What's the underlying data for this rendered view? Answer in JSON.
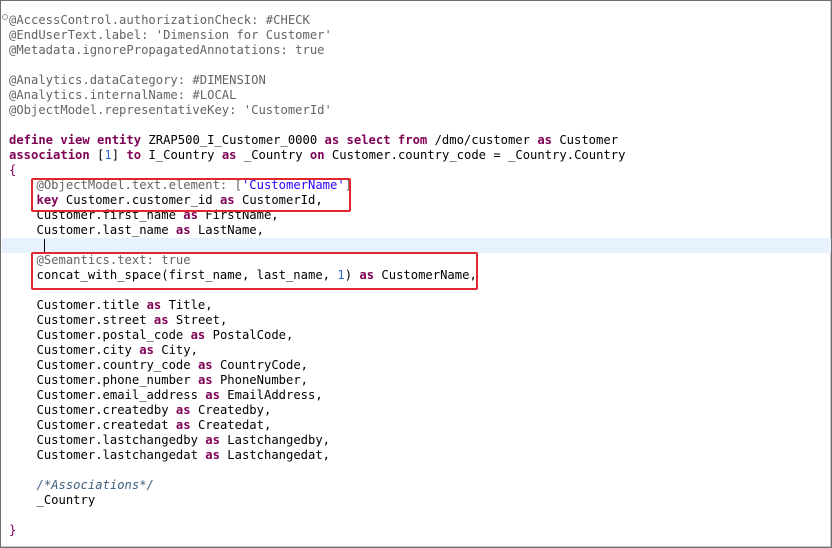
{
  "editor": {
    "lines": [
      {
        "text": "@AccessControl.authorizationCheck: #CHECK"
      },
      {
        "text": "@EndUserText.label: 'Dimension for Customer'"
      },
      {
        "text": "@Metadata.ignorePropagatedAnnotations: true"
      },
      {
        "text": ""
      },
      {
        "text": "@Analytics.dataCategory: #DIMENSION"
      },
      {
        "text": "@Analytics.internalName: #LOCAL"
      },
      {
        "text": "@ObjectModel.representativeKey: 'CustomerId'"
      },
      {
        "text": ""
      },
      {
        "text": "define view entity ZRAP500_I_Customer_0000 as select from /dmo/customer as Customer"
      },
      {
        "text": "association [1] to I_Country as _Country on Customer.country_code = _Country.Country"
      },
      {
        "text": "{"
      },
      {
        "text": "    @ObjectModel.text.element: ['CustomerName']"
      },
      {
        "text": "    key Customer.customer_id as CustomerId,"
      },
      {
        "text": "    Customer.first_name as FirstName,"
      },
      {
        "text": "    Customer.last_name as LastName,"
      },
      {
        "text": "    "
      },
      {
        "text": "    @Semantics.text: true"
      },
      {
        "text": "    concat_with_space(first_name, last_name, 1) as CustomerName,"
      },
      {
        "text": ""
      },
      {
        "text": "    Customer.title as Title,"
      },
      {
        "text": "    Customer.street as Street,"
      },
      {
        "text": "    Customer.postal_code as PostalCode,"
      },
      {
        "text": "    Customer.city as City,"
      },
      {
        "text": "    Customer.country_code as CountryCode,"
      },
      {
        "text": "    Customer.phone_number as PhoneNumber,"
      },
      {
        "text": "    Customer.email_address as EmailAddress,"
      },
      {
        "text": "    Customer.createdby as Createdby,"
      },
      {
        "text": "    Customer.createdat as Createdat,"
      },
      {
        "text": "    Customer.lastchangedby as Lastchangedby,"
      },
      {
        "text": "    Customer.lastchangedat as Lastchangedat,"
      },
      {
        "text": ""
      },
      {
        "text": "    /*Associations*/"
      },
      {
        "text": "    _Country"
      },
      {
        "text": ""
      },
      {
        "text": "}"
      }
    ],
    "tokens": {
      "l0": "@AccessControl.authorizationCheck: #CHECK",
      "l1": "@EndUserText.label: 'Dimension for Customer'",
      "l2": "@Metadata.ignorePropagatedAnnotations: true",
      "l4": "@Analytics.dataCategory: #DIMENSION",
      "l5": "@Analytics.internalName: #LOCAL",
      "l6": "@ObjectModel.representativeKey: 'CustomerId'",
      "l8_kw1": "define view entity",
      "l8_a": " ZRAP500_I_Customer_0000 ",
      "l8_kw2": "as select from",
      "l8_b": " /dmo/customer ",
      "l8_kw3": "as",
      "l8_c": " Customer",
      "l9_kw1": "association",
      "l9_a": " [",
      "l9_num": "1",
      "l9_b": "] ",
      "l9_kw2": "to",
      "l9_c": " I_Country ",
      "l9_kw3": "as",
      "l9_d": " _Country ",
      "l9_kw4": "on",
      "l9_e": " Customer.country_code = _Country.Country",
      "l10": "{",
      "l11_anno": "@ObjectModel.text.element: [",
      "l11_str": "'CustomerName'",
      "l11_end": "]",
      "l12_kw": "key",
      "l12_a": " Customer.customer_id ",
      "l12_kw2": "as",
      "l12_b": " CustomerId,",
      "l13_a": "Customer.first_name ",
      "l13_kw": "as",
      "l13_b": " FirstName,",
      "l14_a": "Customer.last_name ",
      "l14_kw": "as",
      "l14_b": " LastName,",
      "l16": "@Semantics.text: true",
      "l17_a": "concat_with_space(first_name, last_name, ",
      "l17_num": "1",
      "l17_b": ") ",
      "l17_kw": "as",
      "l17_c": " CustomerName,",
      "l19_a": "Customer.title ",
      "l19_kw": "as",
      "l19_b": " Title,",
      "l20_a": "Customer.street ",
      "l20_kw": "as",
      "l20_b": " Street,",
      "l21_a": "Customer.postal_code ",
      "l21_kw": "as",
      "l21_b": " PostalCode,",
      "l22_a": "Customer.city ",
      "l22_kw": "as",
      "l22_b": " City,",
      "l23_a": "Customer.country_code ",
      "l23_kw": "as",
      "l23_b": " CountryCode,",
      "l24_a": "Customer.phone_number ",
      "l24_kw": "as",
      "l24_b": " PhoneNumber,",
      "l25_a": "Customer.email_address ",
      "l25_kw": "as",
      "l25_b": " EmailAddress,",
      "l26_a": "Customer.createdby ",
      "l26_kw": "as",
      "l26_b": " Createdby,",
      "l27_a": "Customer.createdat ",
      "l27_kw": "as",
      "l27_b": " Createdat,",
      "l28_a": "Customer.lastchangedby ",
      "l28_kw": "as",
      "l28_b": " Lastchangedby,",
      "l29_a": "Customer.lastchangedat ",
      "l29_kw": "as",
      "l29_b": " Lastchangedat,",
      "l31": "/*Associations*/",
      "l32": "_Country",
      "l34": "}"
    },
    "colors": {
      "keyword": "#7f0055",
      "annotation": "#646464",
      "string": "#2a00ff",
      "number": "#2a6bd6",
      "comment": "#3f5f7f",
      "highlight_box": "#e0262f",
      "current_line": "#e8f2fe"
    }
  }
}
